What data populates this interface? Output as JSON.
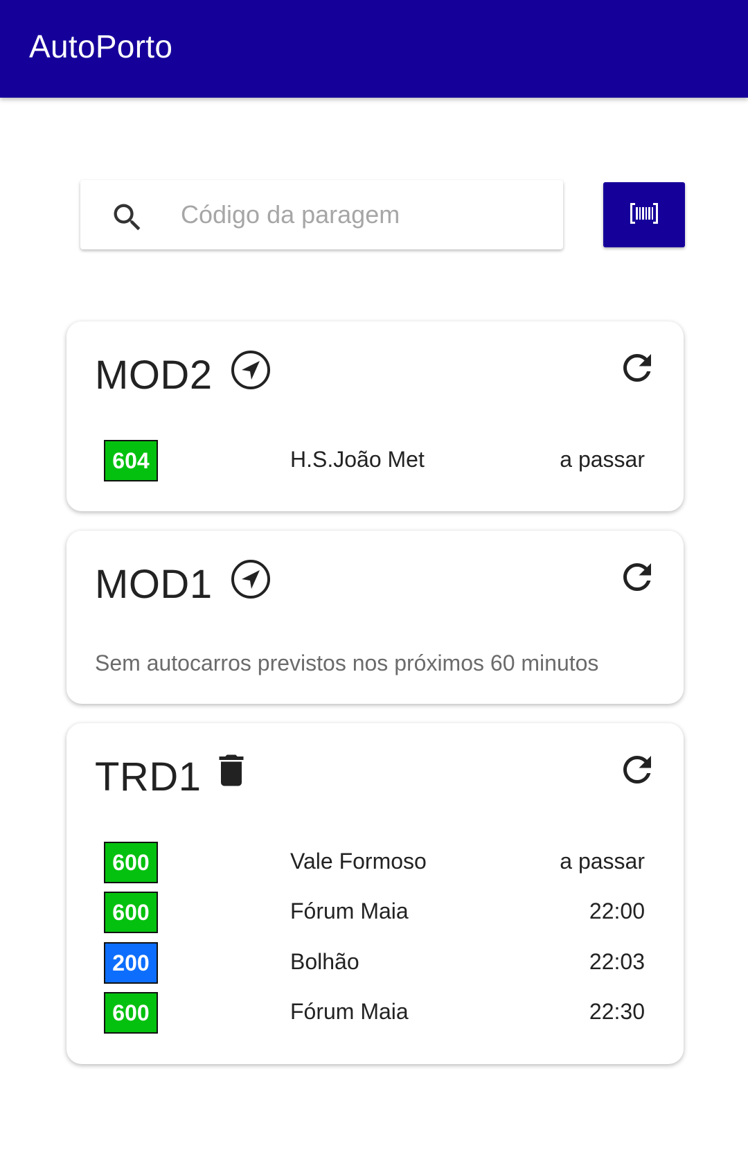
{
  "app": {
    "title": "AutoPorto",
    "bar_color": "#16009a"
  },
  "search": {
    "placeholder": "Código da paragem",
    "value": "",
    "icon": "search-icon"
  },
  "scan_button": {
    "icon": "barcode-scan-icon"
  },
  "line_colors": {
    "green": "#05c10f",
    "blue": "#0d6efd"
  },
  "stops": [
    {
      "code": "MOD2",
      "action_icon": "navigation-icon",
      "refresh_icon": "refresh-icon",
      "arrivals": [
        {
          "line": "604",
          "color": "#05c10f",
          "destination": "H.S.João Met",
          "time": "a passar"
        }
      ]
    },
    {
      "code": "MOD1",
      "action_icon": "navigation-icon",
      "refresh_icon": "refresh-icon",
      "message": "Sem autocarros previstos nos próximos 60 minutos",
      "arrivals": []
    },
    {
      "code": "TRD1",
      "action_icon": "trash-icon",
      "refresh_icon": "refresh-icon",
      "arrivals": [
        {
          "line": "600",
          "color": "#05c10f",
          "destination": "Vale Formoso",
          "time": "a passar"
        },
        {
          "line": "600",
          "color": "#05c10f",
          "destination": "Fórum Maia",
          "time": "22:00"
        },
        {
          "line": "200",
          "color": "#0d6efd",
          "destination": "Bolhão",
          "time": "22:03"
        },
        {
          "line": "600",
          "color": "#05c10f",
          "destination": "Fórum Maia",
          "time": "22:30"
        }
      ]
    }
  ]
}
